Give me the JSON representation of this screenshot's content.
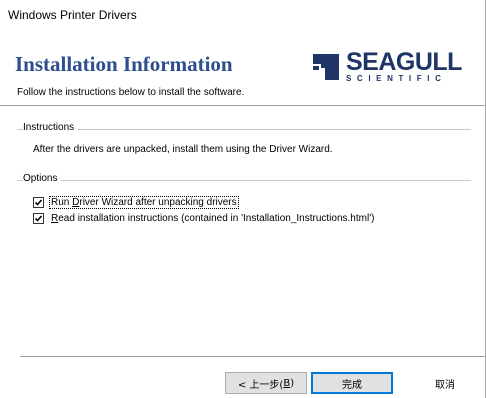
{
  "window": {
    "title": "Windows Printer Drivers"
  },
  "header": {
    "title": "Installation Information",
    "subtitle": "Follow the instructions below to install the software.",
    "logo": {
      "word": "SEAGULL",
      "sub": "SCIENTIFIC",
      "icon": "seagull-logo-icon",
      "color": "#1f3566"
    },
    "title_color": "#2d4f8e"
  },
  "instructions": {
    "group_label": "Instructions",
    "text": "After the drivers are unpacked, install them using the Driver Wizard."
  },
  "options": {
    "group_label": "Options",
    "items": [
      {
        "label_before": "Run ",
        "label_accel": "D",
        "label_after": "river Wizard after unpacking drivers",
        "checked": true,
        "icon": "checkmark-icon"
      },
      {
        "label_before": "",
        "label_accel": "R",
        "label_after": "ead installation instructions (contained in 'Installation_Instructions.html')",
        "checked": true,
        "icon": "checkmark-icon"
      }
    ]
  },
  "footer": {
    "back_label": "< 上一步(",
    "back_accel": "B",
    "back_close": ")",
    "finish_label": "完成",
    "cancel_label": "取消"
  }
}
